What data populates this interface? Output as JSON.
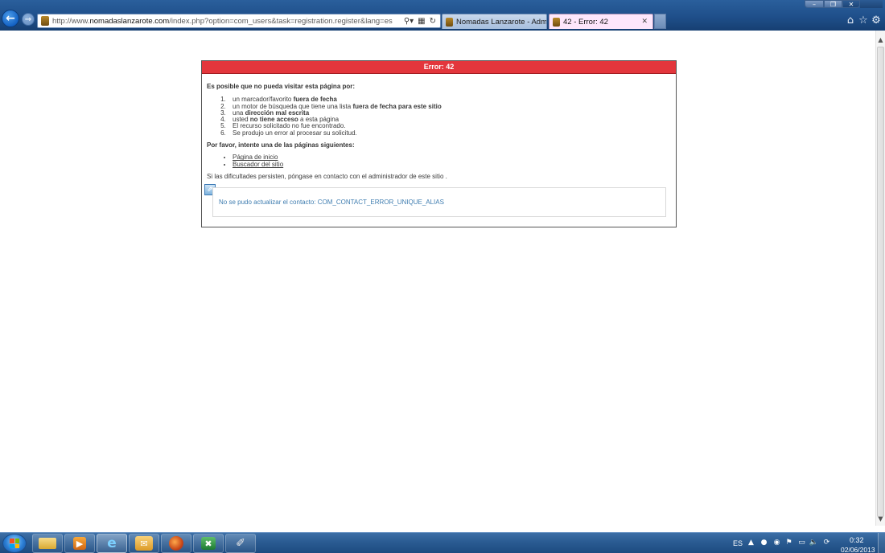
{
  "browser": {
    "address": {
      "prefix": "http://www.",
      "domain": "nomadaslanzarote.com",
      "path": "/index.php?option=com_users&task=registration.register&lang=es"
    },
    "tabs": [
      {
        "label": "Nomadas Lanzarote - Adminis..."
      },
      {
        "label": "42 - Error: 42"
      }
    ]
  },
  "error_page": {
    "title": "Error: 42",
    "intro": "Es posible que no pueda visitar esta página por:",
    "reasons": [
      {
        "pre": "un marcador/favorito ",
        "bold": "fuera de fecha",
        "post": ""
      },
      {
        "pre": "un motor de búsqueda que tiene una lista ",
        "bold": "fuera de fecha para este sitio",
        "post": ""
      },
      {
        "pre": "una ",
        "bold": "dirección mal escrita",
        "post": ""
      },
      {
        "pre": "usted ",
        "bold": "no tiene acceso",
        "post": " a esta página"
      },
      {
        "pre": "El recurso solicitado no fue encontrado.",
        "bold": "",
        "post": ""
      },
      {
        "pre": "Se produjo un error al procesar su solicitud.",
        "bold": "",
        "post": ""
      }
    ],
    "please": "Por favor, intente una de las páginas siguientes:",
    "links": [
      "Página de inicio",
      "Buscador del sitio"
    ],
    "persist": "Si las dificultades persisten, póngase en contacto con el administrador de este sitio .",
    "message": "No se pudo actualizar el contacto: COM_CONTACT_ERROR_UNIQUE_ALIAS"
  },
  "taskbar": {
    "language": "ES",
    "time": "0:32",
    "date": "02/06/2013"
  },
  "colors": {
    "error_header": "#e3363c",
    "message_text": "#3f7db0",
    "active_tab": "#fde6fb"
  }
}
